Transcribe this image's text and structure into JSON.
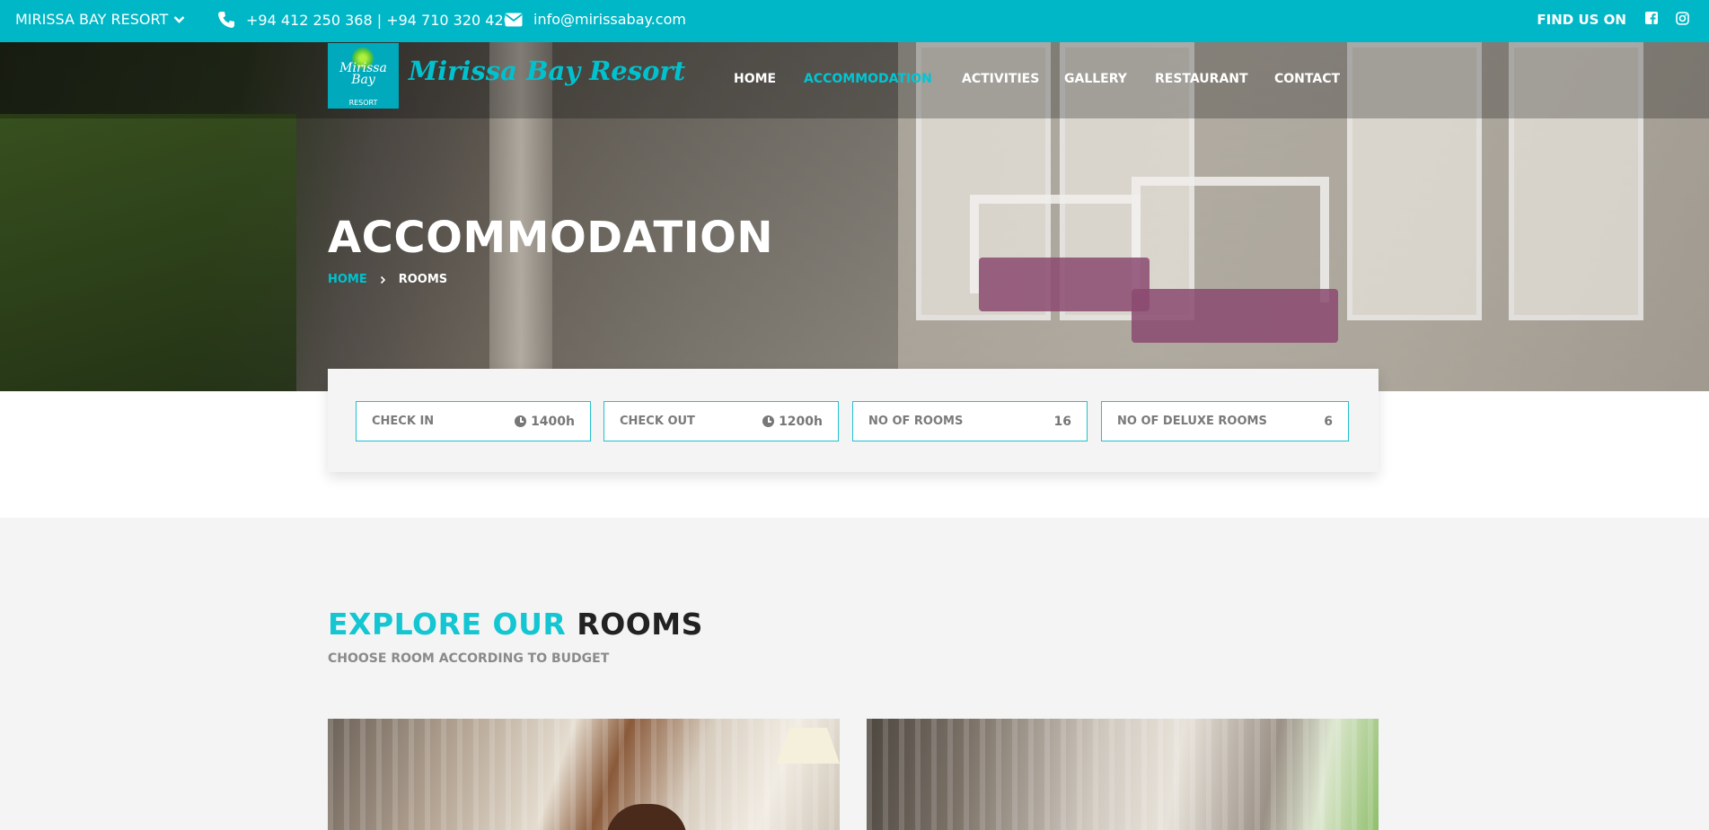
{
  "topbar": {
    "resort_selector": "MIRISSA BAY RESORT",
    "phone": "+94 412 250 368 | +94 710 320 420",
    "email": "info@mirissabay.com",
    "find_us": "FIND US ON",
    "social": [
      "facebook-icon",
      "instagram-icon"
    ]
  },
  "brand": {
    "logo_script": "Mirissa Bay",
    "logo_small": "RESORT",
    "name": "Mirissa Bay Resort"
  },
  "nav": {
    "items": [
      "HOME",
      "ACCOMMODATION",
      "ACTIVITIES",
      "GALLERY",
      "RESTAURANT",
      "CONTACT"
    ],
    "active": "ACCOMMODATION"
  },
  "hero": {
    "title": "ACCOMMODATION",
    "breadcrumb_home": "HOME",
    "breadcrumb_current": "ROOMS"
  },
  "info": {
    "check_in_label": "CHECK IN",
    "check_in_value": "1400h",
    "check_out_label": "CHECK OUT",
    "check_out_value": "1200h",
    "rooms_label": "NO OF ROOMS",
    "rooms_value": "16",
    "deluxe_label": "NO OF DELUXE ROOMS",
    "deluxe_value": "6"
  },
  "explore": {
    "title_a": "EXPLORE OUR",
    "title_b": "ROOMS",
    "subtitle": "CHOOSE ROOM ACCORDING TO BUDGET"
  },
  "colors": {
    "accent": "#00b7c7",
    "heading_dark": "#222222",
    "muted": "#8a8a8a"
  }
}
